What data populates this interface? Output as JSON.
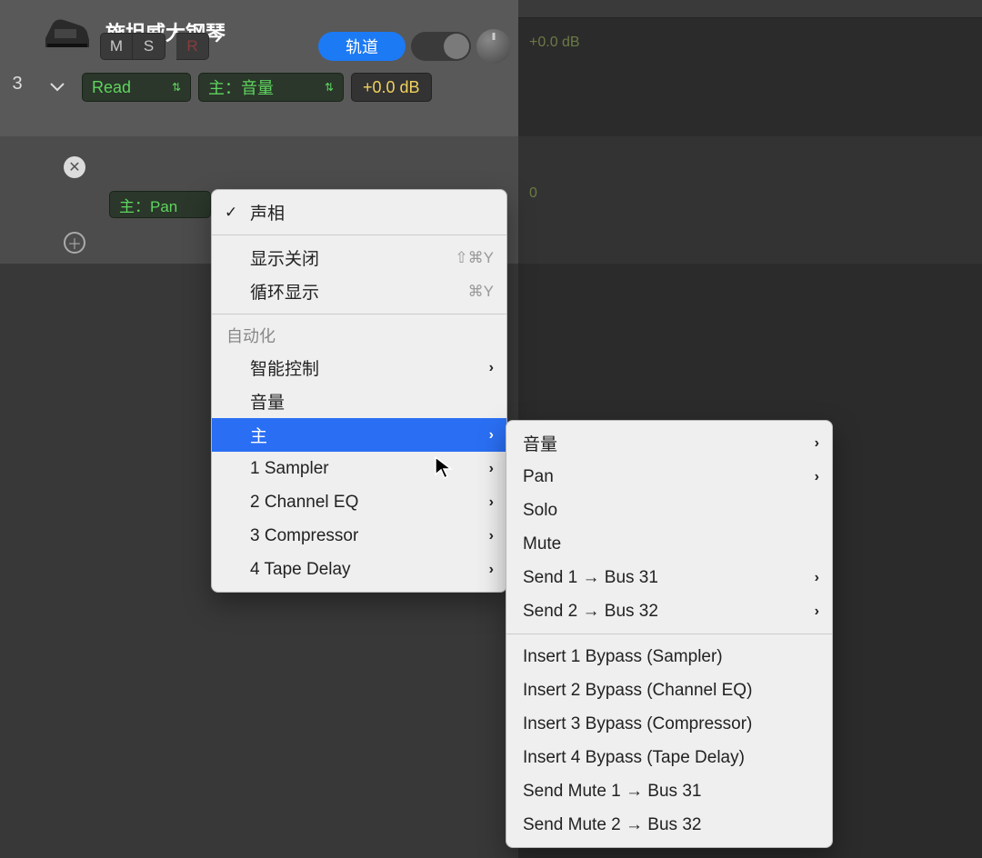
{
  "track": {
    "number": "3",
    "title": "施坦威大钢琴",
    "mute": "M",
    "solo": "S",
    "record": "R",
    "pill": "轨道",
    "automation_mode": "Read",
    "param": "主：音量",
    "db": "+0.0 dB"
  },
  "subtrack": {
    "pan": "主：Pan"
  },
  "timeline": {
    "db_label": "+0.0 dB",
    "zero": "0"
  },
  "menu1": {
    "checked": "声相",
    "show_off": "显示关闭",
    "show_off_kbd": "⇧⌘Y",
    "cycle_show": "循环显示",
    "cycle_show_kbd": "⌘Y",
    "section": "自动化",
    "smart": "智能控制",
    "volume": "音量",
    "main": "主",
    "plug1": "1 Sampler",
    "plug2": "2 Channel EQ",
    "plug3": "3 Compressor",
    "plug4": "4 Tape Delay"
  },
  "menu2": {
    "volume": "音量",
    "pan": "Pan",
    "solo": "Solo",
    "mute": "Mute",
    "send1": "Send 1 → Bus 31",
    "send2": "Send 2 → Bus 32",
    "ins1": "Insert 1 Bypass (Sampler)",
    "ins2": "Insert 2 Bypass (Channel EQ)",
    "ins3": "Insert 3 Bypass (Compressor)",
    "ins4": "Insert 4 Bypass (Tape Delay)",
    "sm1": "Send Mute 1 → Bus 31",
    "sm2": "Send Mute 2 → Bus 32"
  }
}
